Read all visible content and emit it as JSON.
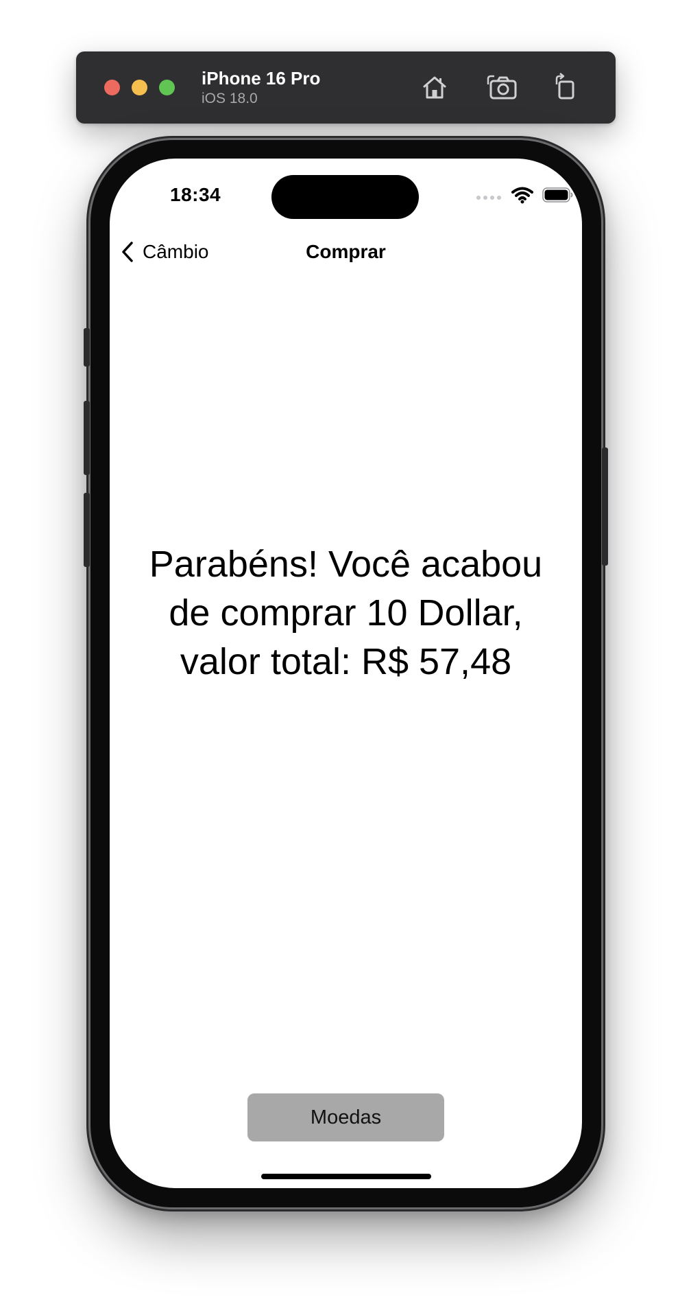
{
  "simulator": {
    "device_name": "iPhone 16 Pro",
    "os_version": "iOS 18.0",
    "toolbar_icons": [
      "home-icon",
      "screenshot-camera-icon",
      "rotate-icon"
    ]
  },
  "status_bar": {
    "time": "18:34",
    "icons": [
      "cellular-dots-icon",
      "wifi-icon",
      "battery-icon"
    ]
  },
  "nav": {
    "back_label": "Câmbio",
    "title": "Comprar"
  },
  "main": {
    "message": "Parabéns! Você acabou de comprar 10 Dollar, valor total: R$ 57,48"
  },
  "bottom": {
    "button_label": "Moedas"
  },
  "colors": {
    "button_bg": "#a8a8a8",
    "sim_bar_bg": "#2f2f31",
    "traffic_red": "#ec6a5e",
    "traffic_yellow": "#f4bf4f",
    "traffic_green": "#61c554"
  }
}
